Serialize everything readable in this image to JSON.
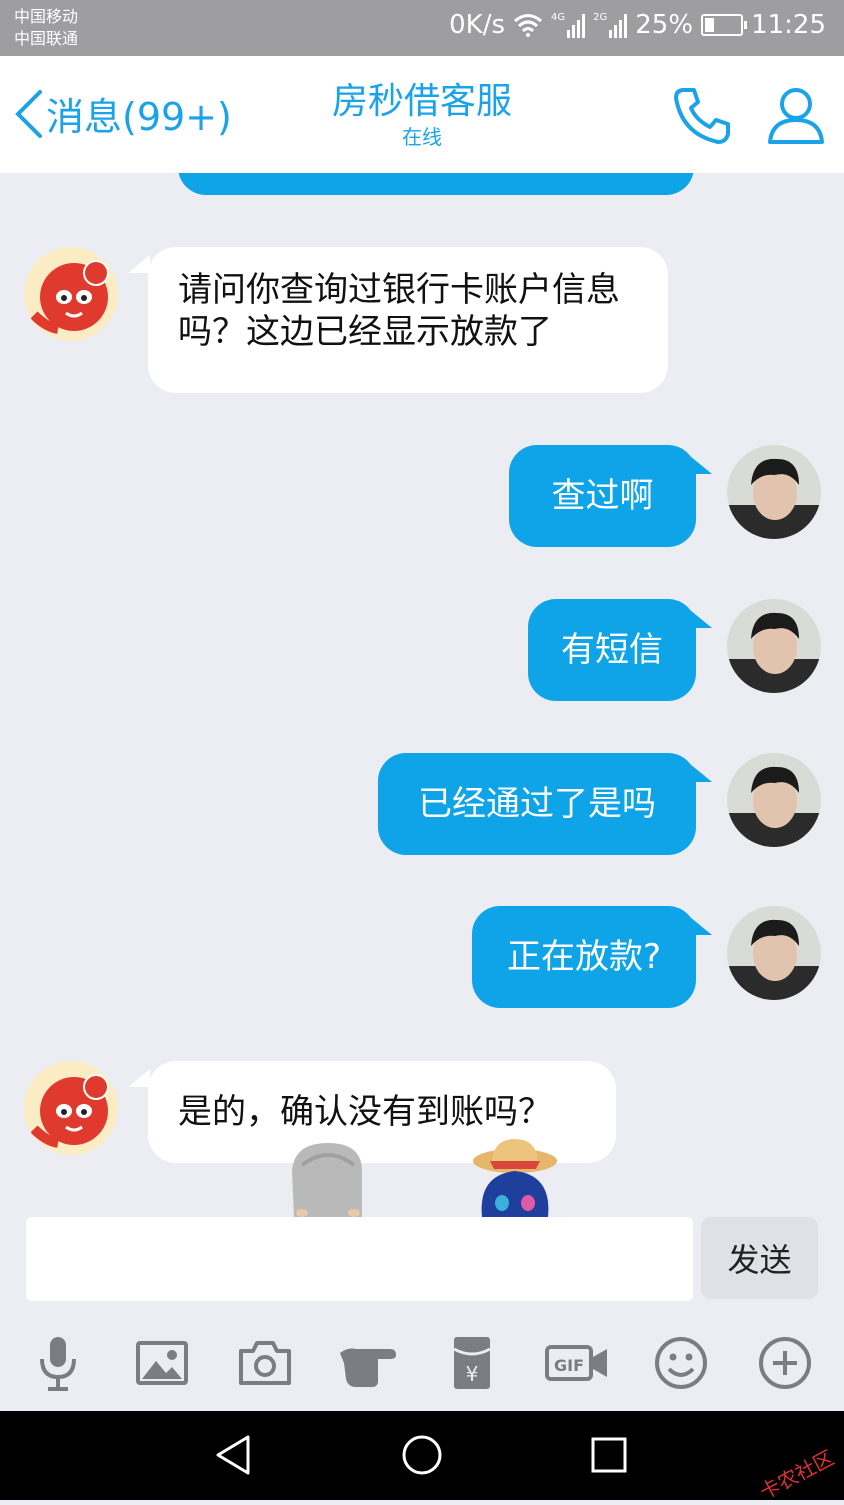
{
  "status_bar": {
    "carrier_1": "中国移动",
    "carrier_2": "中国联通",
    "net_speed": "0K/s",
    "sim1_tag": "4G",
    "sim2_tag": "2G",
    "battery": "25%",
    "time": "11:25"
  },
  "header": {
    "back_label": "消息(99+)",
    "title": "房秒借客服",
    "subtitle": "在线",
    "phone_icon": "phone-icon",
    "profile_icon": "person-icon"
  },
  "colors": {
    "accent": "#1aa3e8",
    "outgoing_bubble": "#0fa3e7",
    "incoming_bubble": "#ffffff",
    "chat_bg": "#ebedf2"
  },
  "messages": [
    {
      "direction": "in",
      "text": "请问你查询过银行卡账户信息吗？这边已经显示放款了"
    },
    {
      "direction": "out",
      "text": "查过啊"
    },
    {
      "direction": "out",
      "text": "有短信"
    },
    {
      "direction": "out",
      "text": "已经通过了是吗"
    },
    {
      "direction": "out",
      "text": "正在放款?"
    },
    {
      "direction": "in",
      "text": "是的，确认没有到账吗？"
    }
  ],
  "composer": {
    "input_value": "",
    "send_label": "发送"
  },
  "toolbar": [
    "microphone-icon",
    "image-icon",
    "camera-icon",
    "poke-icon",
    "red-packet-icon",
    "gif-icon",
    "emoji-icon",
    "plus-icon"
  ],
  "watermark": "卡农社区"
}
